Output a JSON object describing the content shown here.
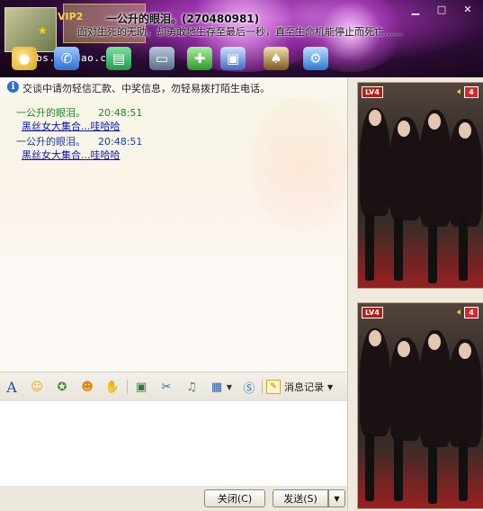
{
  "header": {
    "vip": "VIP2",
    "name": "一公升的眼泪。",
    "qq_number": "(270480981)",
    "signature": "面对生死的无助，却勇敢地生存至最后一秒，直至生命机能停止而死亡......",
    "watermark": "bbs.houdao.com",
    "window_controls": {
      "minimize": "▁",
      "maximize": "□",
      "close": "✕"
    }
  },
  "toolbar": {
    "icons": [
      "video-chat-icon",
      "voice-chat-icon",
      "send-file-icon",
      "screen-share-icon",
      "add-contact-icon",
      "remote-assist-icon",
      "app-center-icon",
      "settings-icon"
    ]
  },
  "notice": {
    "text": "交谈中请勿轻信汇款、中奖信息，勿轻易拨打陌生电话。"
  },
  "messages": [
    {
      "sender": "一公升的眼泪。",
      "time": "20:48:51",
      "body": "黑丝女大集合...哇哈哈",
      "sender_color": "#1a8a2a"
    },
    {
      "sender": "一公升的眼泪。",
      "time": "20:48:51",
      "body": "黑丝女大集合...哇哈哈",
      "sender_color": "#1a3ea8"
    }
  ],
  "format_toolbar": {
    "font": "A",
    "history_label": "消息记录",
    "history_arrow": "▼",
    "icons": [
      "font-icon",
      "emoticon-icon",
      "magic-emoticon-icon",
      "nudge-icon",
      "gift-icon",
      "image-icon",
      "screenshot-icon",
      "music-icon",
      "app-icon",
      "sms-icon"
    ]
  },
  "bottom": {
    "close_label": "关闭(C)",
    "send_label": "发送(S)",
    "send_menu_arrow": "▼"
  },
  "right_panel": {
    "photos": [
      {
        "level": "LV4",
        "count": "4"
      },
      {
        "level": "LV4",
        "count": "4"
      }
    ]
  },
  "colors": {
    "link": "#0a18a8",
    "header_bg": "#2a0c33"
  }
}
